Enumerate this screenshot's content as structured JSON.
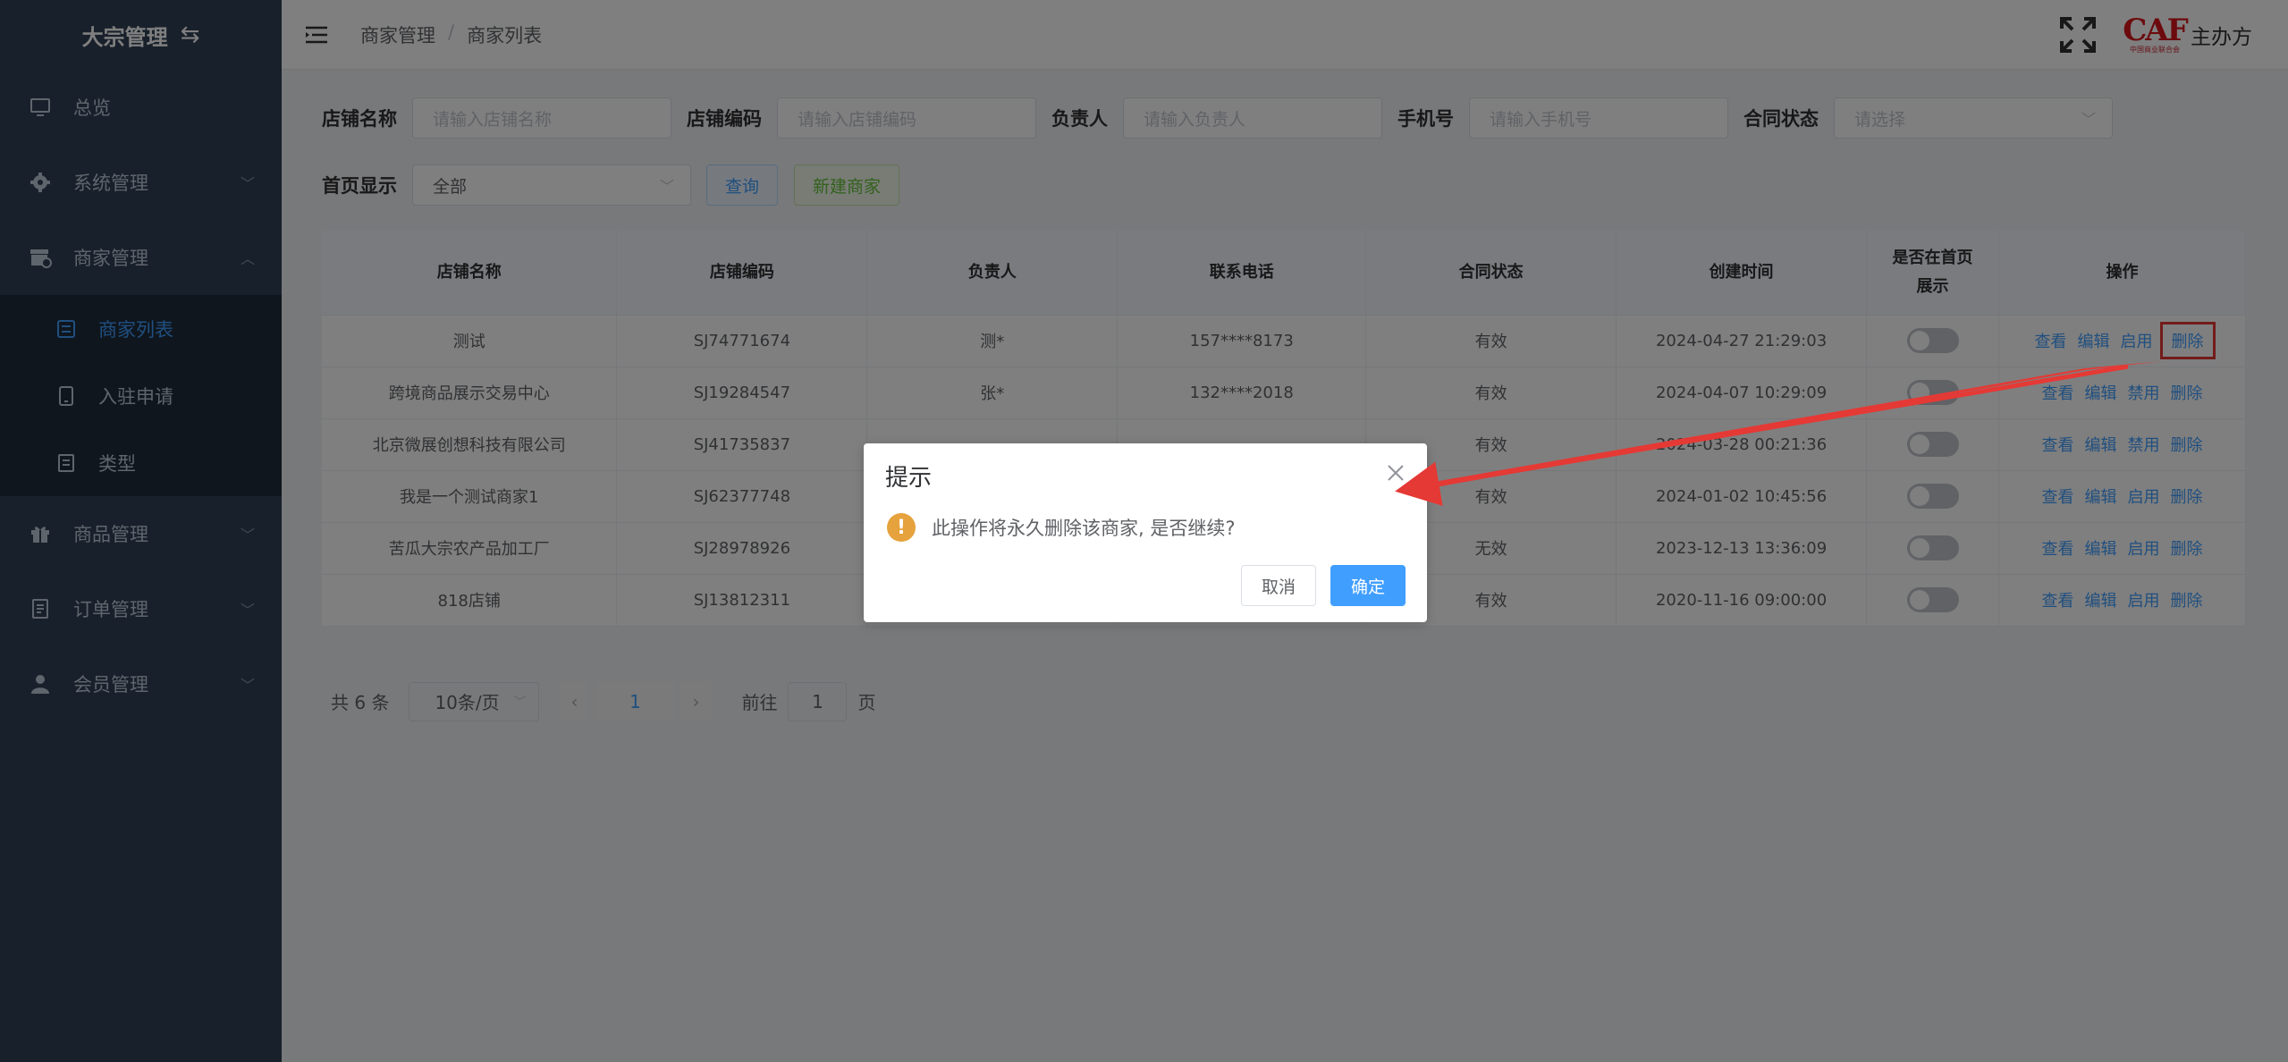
{
  "sidebar": {
    "brand": "大宗管理",
    "brand_icon": "swap-icon",
    "items": [
      {
        "label": "总览",
        "icon": "monitor-icon"
      },
      {
        "label": "系统管理",
        "icon": "gear-icon"
      },
      {
        "label": "商家管理",
        "icon": "store-icon"
      },
      {
        "label": "商品管理",
        "icon": "gift-icon"
      },
      {
        "label": "订单管理",
        "icon": "document-icon"
      },
      {
        "label": "会员管理",
        "icon": "user-icon"
      }
    ],
    "sub_items": [
      {
        "label": "商家列表",
        "icon": "list-icon",
        "active": true
      },
      {
        "label": "入驻申请",
        "icon": "tablet-icon",
        "active": false
      },
      {
        "label": "类型",
        "icon": "doc-icon",
        "active": false
      }
    ]
  },
  "header": {
    "breadcrumb": [
      "商家管理",
      "商家列表"
    ],
    "separator": "/",
    "logo_text": "CAF",
    "logo_subtext": "中国商业联合会",
    "org_name": "主办方"
  },
  "filters": {
    "store_name_label": "店铺名称",
    "store_name_placeholder": "请输入店铺名称",
    "store_code_label": "店铺编码",
    "store_code_placeholder": "请输入店铺编码",
    "owner_label": "负责人",
    "owner_placeholder": "请输入负责人",
    "phone_label": "手机号",
    "phone_placeholder": "请输入手机号",
    "contract_label": "合同状态",
    "contract_placeholder": "请选择",
    "homepage_label": "首页显示",
    "homepage_value": "全部",
    "query_button": "查询",
    "new_button": "新建商家"
  },
  "table": {
    "headers": [
      "店铺名称",
      "店铺编码",
      "负责人",
      "联系电话",
      "合同状态",
      "创建时间",
      "是否在首页展示",
      "操作"
    ],
    "rows": [
      {
        "name": "测试",
        "code": "SJ74771674",
        "owner": "测*",
        "phone": "157****8173",
        "status": "有效",
        "created": "2024-04-27 21:29:03",
        "ops": [
          "查看",
          "编辑",
          "启用",
          "删除"
        ]
      },
      {
        "name": "跨境商品展示交易中心",
        "code": "SJ19284547",
        "owner": "张*",
        "phone": "132****2018",
        "status": "有效",
        "created": "2024-04-07 10:29:09",
        "ops": [
          "查看",
          "编辑",
          "禁用",
          "删除"
        ]
      },
      {
        "name": "北京微展创想科技有限公司",
        "code": "SJ41735837",
        "owner": "",
        "phone": "",
        "status": "有效",
        "created": "2024-03-28 00:21:36",
        "ops": [
          "查看",
          "编辑",
          "禁用",
          "删除"
        ]
      },
      {
        "name": "我是一个测试商家1",
        "code": "SJ62377748",
        "owner": "",
        "phone": "",
        "status": "有效",
        "created": "2024-01-02 10:45:56",
        "ops": [
          "查看",
          "编辑",
          "启用",
          "删除"
        ]
      },
      {
        "name": "苦瓜大宗农产品加工厂",
        "code": "SJ28978926",
        "owner": "",
        "phone": "",
        "status": "无效",
        "created": "2023-12-13 13:36:09",
        "ops": [
          "查看",
          "编辑",
          "启用",
          "删除"
        ]
      },
      {
        "name": "818店铺",
        "code": "SJ13812311",
        "owner": "",
        "phone": "",
        "status": "有效",
        "created": "2020-11-16 09:00:00",
        "ops": [
          "查看",
          "编辑",
          "启用",
          "删除"
        ]
      }
    ]
  },
  "pagination": {
    "total": "共 6 条",
    "page_size": "10条/页",
    "prev": "‹",
    "current": "1",
    "next": "›",
    "goto_label": "前往",
    "goto_value": "1",
    "page_unit": "页"
  },
  "dialog": {
    "title": "提示",
    "message": "此操作将永久删除该商家, 是否继续?",
    "warn_symbol": "!",
    "cancel": "取消",
    "confirm": "确定"
  },
  "colors": {
    "sidebar_bg": "#304156",
    "accent": "#409eff",
    "warning": "#e6a23c",
    "annotation_red": "#e53935"
  }
}
